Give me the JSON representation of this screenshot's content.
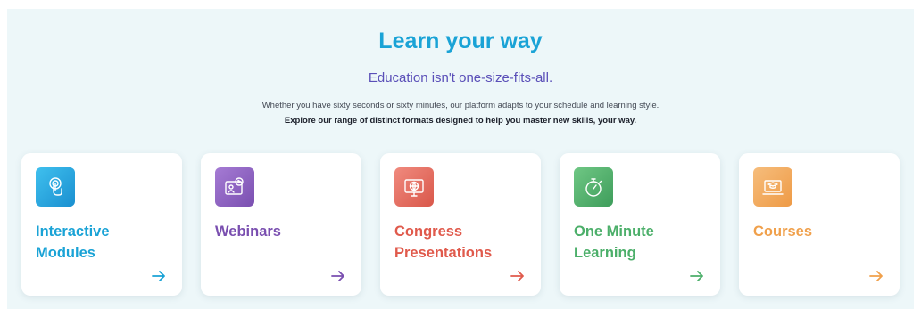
{
  "header": {
    "title": "Learn your way",
    "subtitle": "Education isn't one-size-fits-all.",
    "description": "Whether you have sixty seconds or sixty minutes, our platform adapts to your schedule and learning style.",
    "description_bold": "Explore our range of distinct formats designed to help you master new skills, your way."
  },
  "cards": [
    {
      "label": "Interactive Modules",
      "icon": "touch-screen-icon",
      "color": "#1aa3d6",
      "icon_gradient": [
        "#3fc0ee",
        "#1a8fd0"
      ]
    },
    {
      "label": "Webinars",
      "icon": "video-presentation-icon",
      "color": "#7a4fb0",
      "icon_gradient": [
        "#a57bd4",
        "#7a4fb0"
      ]
    },
    {
      "label": "Congress Presentations",
      "icon": "globe-monitor-icon",
      "color": "#e05a4c",
      "icon_gradient": [
        "#f08a7e",
        "#d9574a"
      ]
    },
    {
      "label": "One Minute Learning",
      "icon": "stopwatch-icon",
      "color": "#4caf6a",
      "icon_gradient": [
        "#6fc784",
        "#3e9d5b"
      ]
    },
    {
      "label": "Courses",
      "icon": "graduation-laptop-icon",
      "color": "#f0a04b",
      "icon_gradient": [
        "#f6bd7c",
        "#ee9a45"
      ]
    }
  ]
}
